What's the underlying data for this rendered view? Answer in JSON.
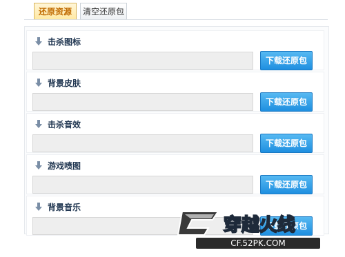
{
  "tabs": [
    {
      "label": "还原资源",
      "active": true
    },
    {
      "label": "清空还原包",
      "active": false
    }
  ],
  "resources": [
    {
      "label": "击杀图标",
      "button": "下载还原包"
    },
    {
      "label": "背景皮肤",
      "button": "下载还原包"
    },
    {
      "label": "击杀音效",
      "button": "下载还原包"
    },
    {
      "label": "游戏喷图",
      "button": "下载还原包"
    },
    {
      "label": "背景音乐",
      "button": "下载还原包"
    }
  ],
  "watermark": {
    "text": "CF.52PK.COM",
    "logo_text": "穿越火线"
  },
  "colors": {
    "accent": "#1f8fe0",
    "active_tab": "#c06a00",
    "label": "#1f3550"
  }
}
